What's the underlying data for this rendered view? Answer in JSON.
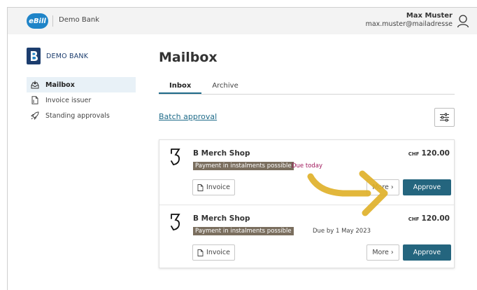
{
  "topbar": {
    "logo_text": "eBill",
    "bank_name": "Demo Bank",
    "user_name": "Max Muster",
    "user_email": "max.muster@mailadresse"
  },
  "sidebar": {
    "brand_name": "DEMO BANK",
    "items": [
      {
        "label": "Mailbox",
        "icon": "mailbox-icon",
        "active": true
      },
      {
        "label": "Invoice issuer",
        "icon": "document-icon",
        "active": false
      },
      {
        "label": "Standing approvals",
        "icon": "rocket-icon",
        "active": false
      }
    ]
  },
  "main": {
    "title": "Mailbox",
    "tabs": [
      {
        "label": "Inbox",
        "active": true
      },
      {
        "label": "Archive",
        "active": false
      }
    ],
    "batch_approval": "Batch approval"
  },
  "bills": [
    {
      "merchant": "B Merch Shop",
      "badge": "Payment in instalments possible",
      "due": "Due today",
      "currency": "CHF",
      "amount": "120.00",
      "invoice_label": "Invoice",
      "more_label": "More ›",
      "approve_label": "Approve"
    },
    {
      "merchant": "B Merch Shop",
      "badge": "Payment in instalments possible",
      "due": "Due by 1 May 2023",
      "currency": "CHF",
      "amount": "120.00",
      "invoice_label": "Invoice",
      "more_label": "More ›",
      "approve_label": "Approve"
    }
  ],
  "colors": {
    "accent": "#24657e",
    "link": "#1f6b89",
    "due_today": "#a0185c",
    "badge_bg": "#7a6e5e",
    "highlight_arrow": "#e0b12a"
  }
}
